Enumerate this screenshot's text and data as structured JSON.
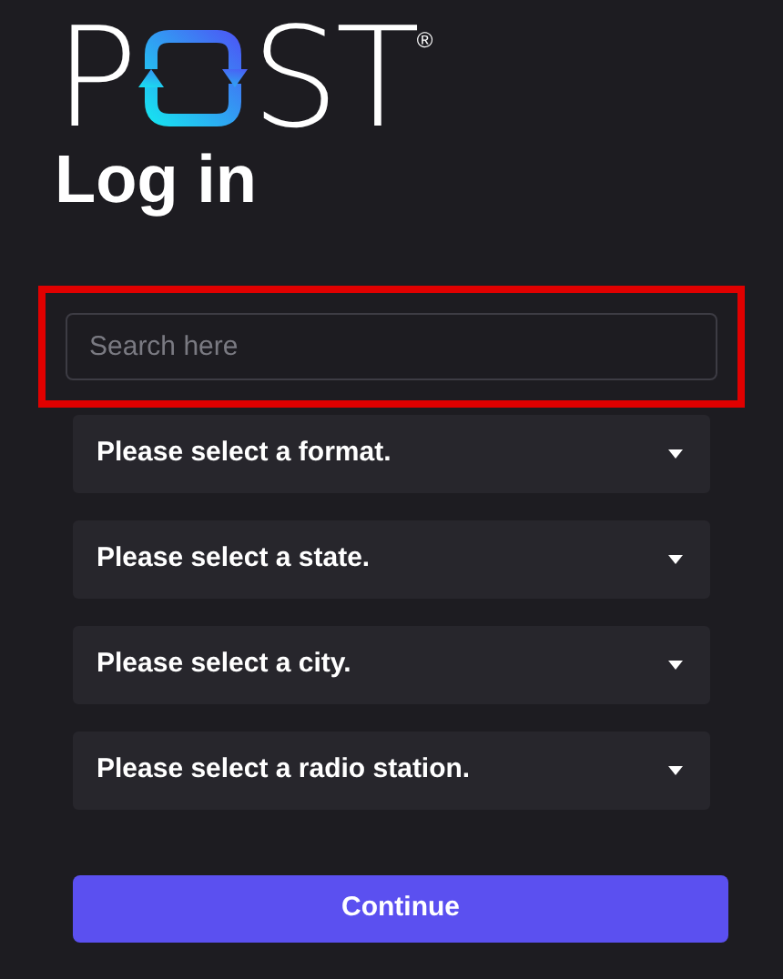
{
  "logo": {
    "left": "P",
    "right": "ST",
    "mark": "®"
  },
  "title": "Log in",
  "search": {
    "placeholder": "Search here",
    "highlighted": true
  },
  "selects": [
    {
      "label": "Please select a format."
    },
    {
      "label": "Please select a state."
    },
    {
      "label": "Please select a city."
    },
    {
      "label": "Please select a radio station."
    }
  ],
  "button": "Continue"
}
